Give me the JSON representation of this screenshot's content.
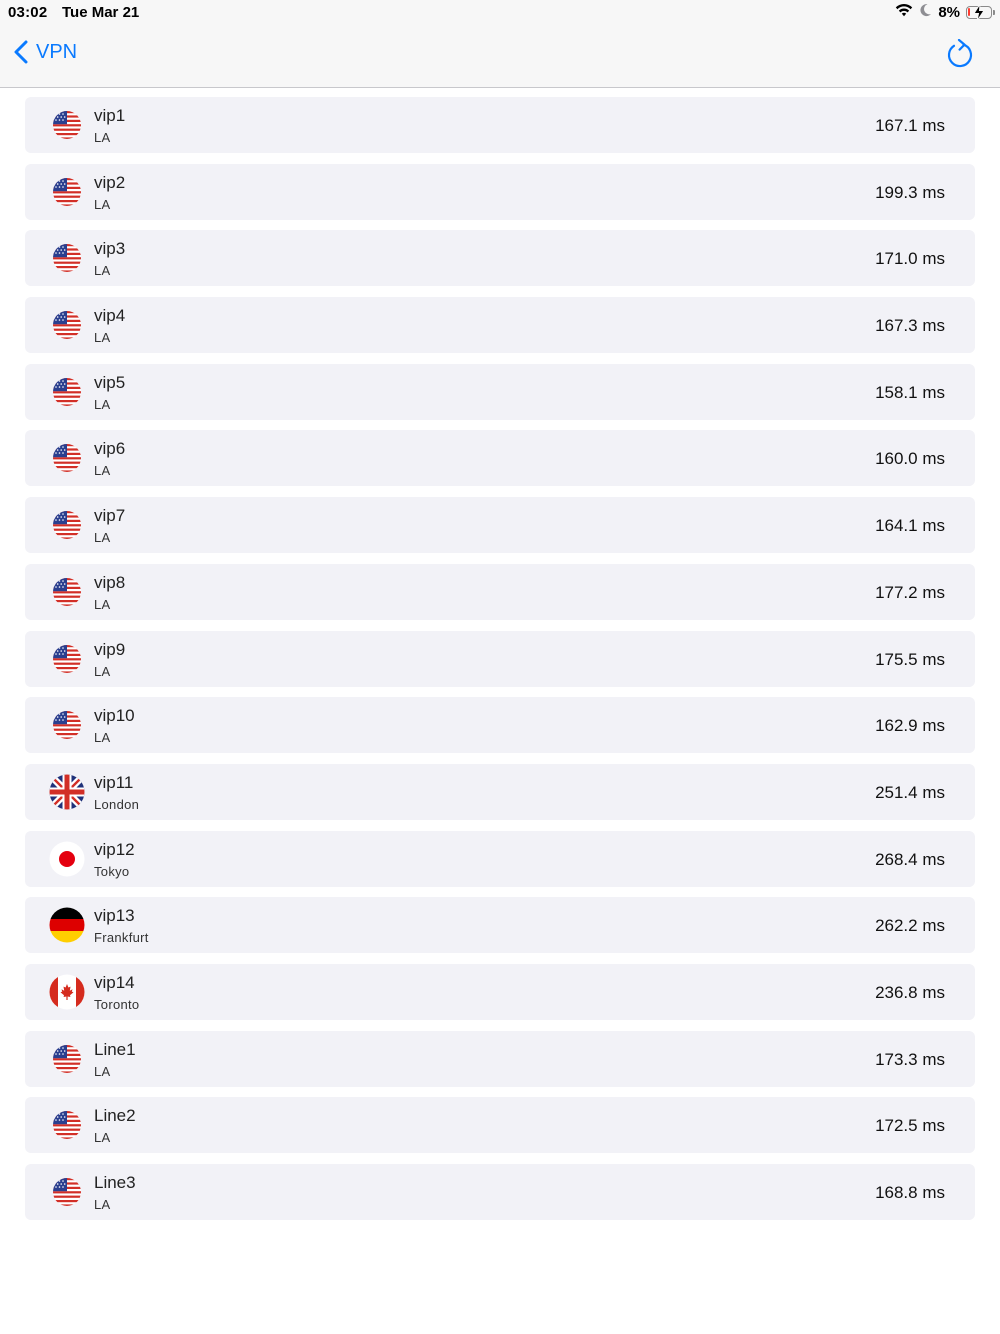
{
  "status_bar": {
    "time": "03:02",
    "date": "Tue Mar 21",
    "battery_percent": "8%",
    "battery_level": 0.08,
    "icons": [
      "wifi-icon",
      "moon-icon",
      "battery-charging-icon"
    ]
  },
  "nav": {
    "back_label": "VPN",
    "accent_color": "#0a7aff",
    "right_icon": "refresh-icon"
  },
  "servers": [
    {
      "name": "vip1",
      "city": "LA",
      "ping": "167.1 ms",
      "flag": "us"
    },
    {
      "name": "vip2",
      "city": "LA",
      "ping": "199.3 ms",
      "flag": "us"
    },
    {
      "name": "vip3",
      "city": "LA",
      "ping": "171.0 ms",
      "flag": "us"
    },
    {
      "name": "vip4",
      "city": "LA",
      "ping": "167.3 ms",
      "flag": "us"
    },
    {
      "name": "vip5",
      "city": "LA",
      "ping": "158.1 ms",
      "flag": "us"
    },
    {
      "name": "vip6",
      "city": "LA",
      "ping": "160.0 ms",
      "flag": "us"
    },
    {
      "name": "vip7",
      "city": "LA",
      "ping": "164.1 ms",
      "flag": "us"
    },
    {
      "name": "vip8",
      "city": "LA",
      "ping": "177.2 ms",
      "flag": "us"
    },
    {
      "name": "vip9",
      "city": "LA",
      "ping": "175.5 ms",
      "flag": "us"
    },
    {
      "name": "vip10",
      "city": "LA",
      "ping": "162.9 ms",
      "flag": "us"
    },
    {
      "name": "vip11",
      "city": "London",
      "ping": "251.4 ms",
      "flag": "uk"
    },
    {
      "name": "vip12",
      "city": "Tokyo",
      "ping": "268.4 ms",
      "flag": "jp"
    },
    {
      "name": "vip13",
      "city": "Frankfurt",
      "ping": "262.2 ms",
      "flag": "de"
    },
    {
      "name": "vip14",
      "city": "Toronto",
      "ping": "236.8 ms",
      "flag": "ca"
    },
    {
      "name": "Line1",
      "city": "LA",
      "ping": "173.3 ms",
      "flag": "us"
    },
    {
      "name": "Line2",
      "city": "LA",
      "ping": "172.5 ms",
      "flag": "us"
    },
    {
      "name": "Line3",
      "city": "LA",
      "ping": "168.8 ms",
      "flag": "us"
    }
  ]
}
